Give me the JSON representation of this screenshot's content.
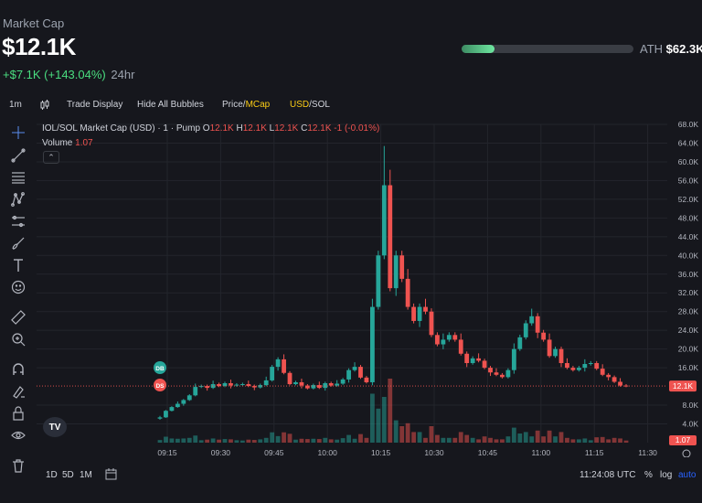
{
  "header": {
    "label": "Market Cap",
    "market_cap": "$12.1K",
    "change": "+$7.1K (+143.04%)",
    "period": "24hr",
    "ath_label": "ATH",
    "ath_value": "$62.3K",
    "ath_progress": 0.19
  },
  "toolbar": {
    "interval": "1m",
    "trade_display": "Trade Display",
    "hide_bubbles": "Hide All Bubbles",
    "price_label": "Price/",
    "mcap_label": "MCap",
    "usd_label": "USD",
    "sol_label": "/SOL"
  },
  "legend": {
    "symbol": "IOL/SOL Market Cap (USD) · 1 · Pump",
    "o_label": "O",
    "o_val": "12.1K",
    "h_label": "H",
    "h_val": "12.1K",
    "l_label": "L",
    "l_val": "12.1K",
    "c_label": "C",
    "c_val": "12.1K",
    "change": "-1 (-0.01%)",
    "volume_label": "Volume",
    "volume_val": "1.07"
  },
  "bottombar": {
    "range_1d": "1D",
    "range_5d": "5D",
    "range_1m": "1M",
    "time": "11:24:08 UTC",
    "percent": "%",
    "log": "log",
    "auto": "auto"
  },
  "markers": {
    "db": "DB",
    "ds": "DS"
  },
  "colors": {
    "up": "#26a69a",
    "down": "#ef5350",
    "bg": "#16171d",
    "grid": "#23252c",
    "accent": "#facc15"
  },
  "chart_data": {
    "type": "candlestick",
    "y_axis_labels": [
      "68.0K",
      "64.0K",
      "60.0K",
      "56.0K",
      "52.0K",
      "48.0K",
      "44.0K",
      "40.0K",
      "36.0K",
      "32.0K",
      "28.0K",
      "24.0K",
      "20.0K",
      "16.0K",
      "12.1K",
      "8.0K",
      "4.0K",
      "1.07"
    ],
    "x_axis_labels": [
      "09:15",
      "09:30",
      "09:45",
      "10:00",
      "10:15",
      "10:30",
      "10:45",
      "11:00",
      "11:15",
      "11:30"
    ],
    "ylim": [
      0,
      68000
    ],
    "current_price": "12.1K",
    "current_volume": "1.07",
    "close_series": [
      5400,
      6800,
      7600,
      8300,
      9100,
      10100,
      11900,
      12100,
      11700,
      12500,
      12100,
      12700,
      12200,
      12400,
      12500,
      12100,
      11800,
      12300,
      13300,
      16200,
      17800,
      14900,
      12500,
      12900,
      12200,
      11600,
      12300,
      11700,
      12700,
      12200,
      12600,
      13500,
      15500,
      16200,
      13900,
      12900,
      29000,
      40000,
      55000,
      33000,
      40000,
      35000,
      29000,
      26000,
      29000,
      28000,
      23000,
      21000,
      22000,
      23000,
      22000,
      19000,
      17000,
      18000,
      17500,
      16000,
      15000,
      14500,
      14000,
      15500,
      20000,
      22500,
      25500,
      27000,
      23500,
      22000,
      18500,
      20000,
      17000,
      16000,
      15500,
      16000,
      16800,
      17000,
      15800,
      14500,
      14000,
      13000,
      12200,
      12100
    ]
  }
}
